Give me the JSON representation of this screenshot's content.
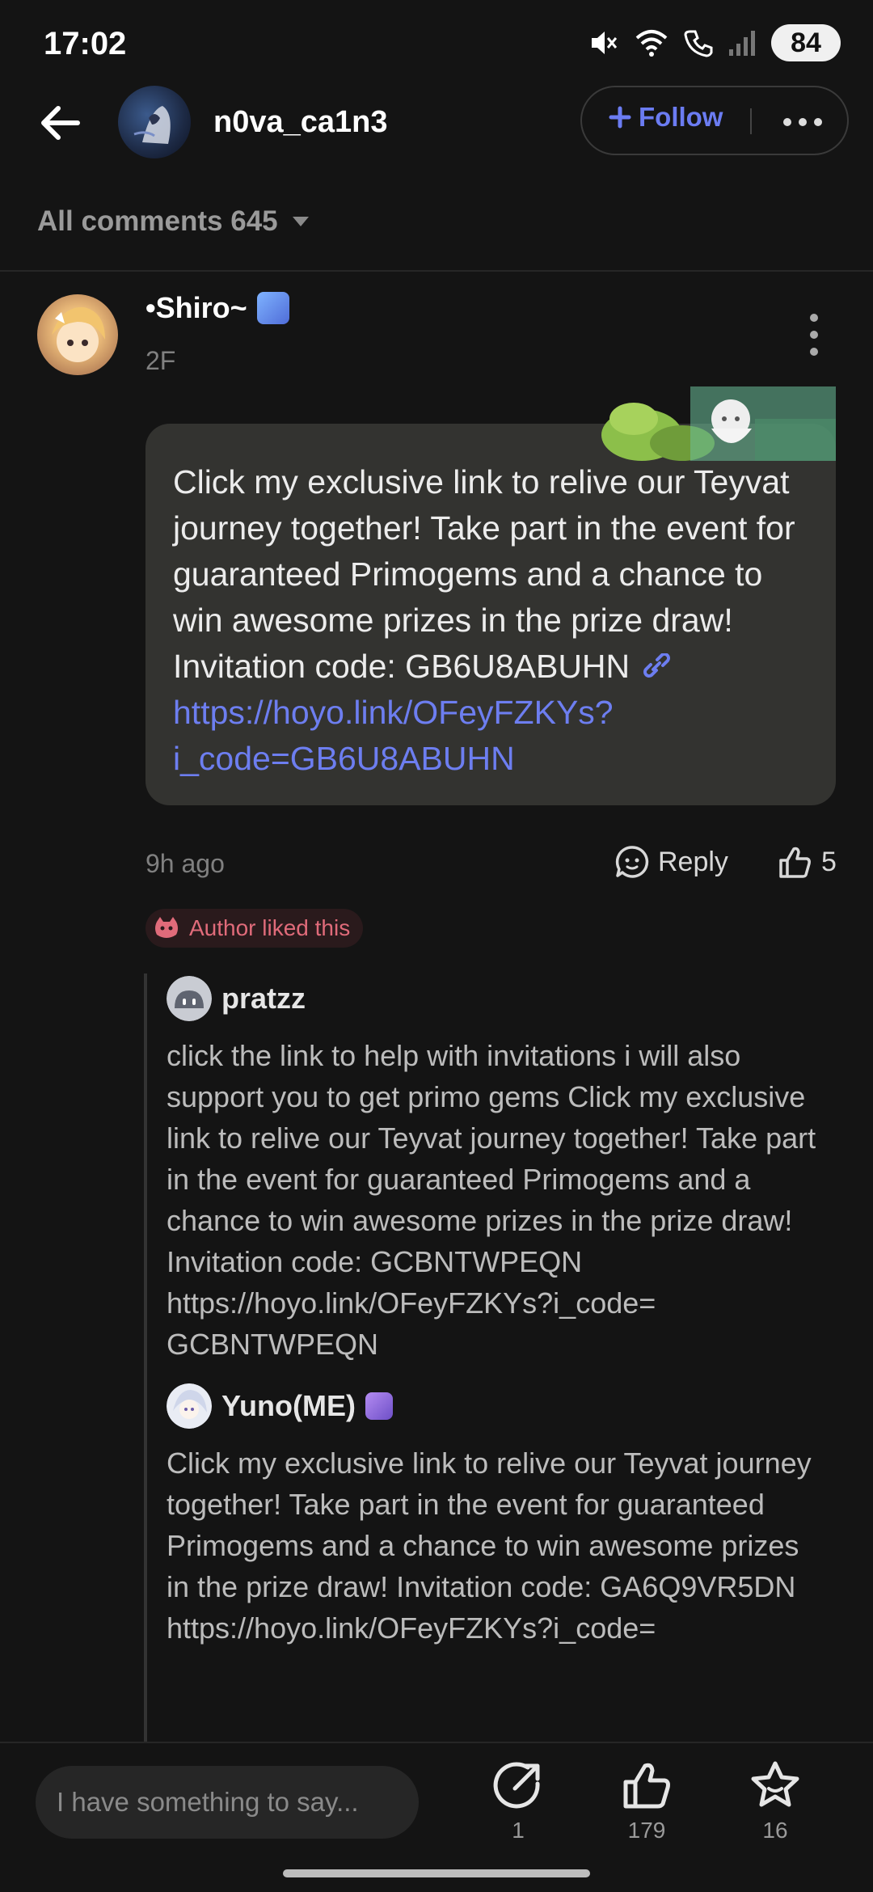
{
  "status_bar": {
    "time": "17:02",
    "battery": "84"
  },
  "header": {
    "username": "n0va_ca1n3",
    "follow_label": "Follow"
  },
  "comments": {
    "title": "All comments 645"
  },
  "main_comment": {
    "author": "•Shiro~",
    "floor": "2F",
    "text_before_link": "Click my exclusive link to relive our Teyvat journey together! Take part in the event for guaranteed Primogems and a chance to win awesome prizes in the prize draw! Invitation code: GB6U8ABUHN ",
    "link": "https://hoyo.link/OFeyFZKYs?i_code=GB6U8ABUHN",
    "time": "9h ago",
    "reply_label": "Reply",
    "likes": "5",
    "author_liked": "Author liked this"
  },
  "replies": [
    {
      "name": "pratzz",
      "text": "click the link to help with invitations i will also support you to get primo gems Click my exclusive link to relive our Teyvat journey together! Take part in the event for guaranteed Primogems and a chance to win awesome prizes in the prize draw! Invitation code: GCBNTWPEQN\nhttps://hoyo.link/OFeyFZKYs?i_code=\nGCBNTWPEQN"
    },
    {
      "name": "Yuno(ME)",
      "text": "Click my exclusive link to relive our Teyvat journey together! Take part in the event for guaranteed Primogems and a chance to win awesome prizes in the prize draw! Invitation code: GA6Q9VR5DN\nhttps://hoyo.link/OFeyFZKYs?i_code="
    }
  ],
  "bottom_bar": {
    "input_placeholder": "I have something to say...",
    "share_count": "1",
    "like_count": "179",
    "collect_count": "16"
  },
  "colors": {
    "accent": "#6b7cf2",
    "liked": "#e06b7a",
    "background": "#141414"
  }
}
